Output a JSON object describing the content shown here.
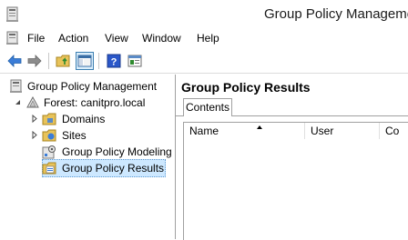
{
  "window": {
    "title": "Group Policy Management"
  },
  "menu": {
    "file": "File",
    "action": "Action",
    "view": "View",
    "window": "Window",
    "help": "Help"
  },
  "toolbar": {
    "buttons": [
      "back-arrow-icon",
      "forward-arrow-icon",
      "up-folder-icon",
      "show-hide-tree-icon",
      "help-icon",
      "properties-icon"
    ]
  },
  "tree": {
    "root": "Group Policy Management",
    "forest": "Forest: canitpro.local",
    "domains": "Domains",
    "sites": "Sites",
    "modeling": "Group Policy Modeling",
    "results": "Group Policy Results"
  },
  "content": {
    "title": "Group Policy Results",
    "tab": "Contents",
    "columns": [
      "Name",
      "User",
      "Co"
    ]
  },
  "colors": {
    "accent": "#3c7fb1",
    "selection": "#cde8ff",
    "arrow": "#3b7dd8"
  }
}
